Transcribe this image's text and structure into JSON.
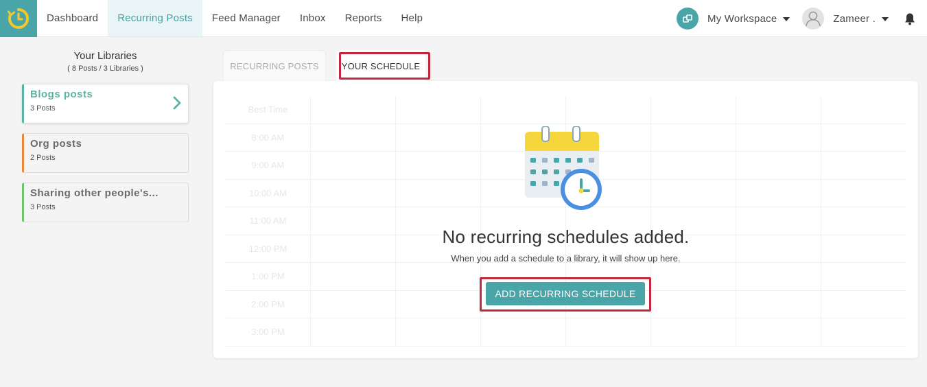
{
  "nav": {
    "items": [
      {
        "label": "Dashboard",
        "active": false
      },
      {
        "label": "Recurring Posts",
        "active": true
      },
      {
        "label": "Feed Manager",
        "active": false
      },
      {
        "label": "Inbox",
        "active": false
      },
      {
        "label": "Reports",
        "active": false
      },
      {
        "label": "Help",
        "active": false
      }
    ],
    "workspace_label": "My Workspace",
    "user_label": "Zameer ."
  },
  "sidebar": {
    "title": "Your Libraries",
    "subtitle": "( 8 Posts / 3 Libraries )",
    "libraries": [
      {
        "name": "Blogs posts",
        "count": "3 Posts",
        "color": "#5bb3a2",
        "active": true
      },
      {
        "name": "Org posts",
        "count": "2 Posts",
        "color": "#e8883a",
        "active": false
      },
      {
        "name": "Sharing other people's...",
        "count": "3 Posts",
        "color": "#6cc56c",
        "active": false
      }
    ]
  },
  "tabs": [
    {
      "label": "RECURRING POSTS",
      "active": false
    },
    {
      "label": "YOUR SCHEDULE",
      "active": true
    }
  ],
  "schedule": {
    "header": "Best Time",
    "times": [
      "8:00 AM",
      "9:00 AM",
      "10:00 AM",
      "11:00 AM",
      "12:00 PM",
      "1:00 PM",
      "2:00 PM",
      "3:00 PM"
    ]
  },
  "empty_state": {
    "title": "No recurring schedules added.",
    "subtitle": "When you add a schedule to a library, it will show up here.",
    "button_label": "ADD RECURRING SCHEDULE"
  },
  "colors": {
    "brand": "#4aa5a8",
    "highlight": "#c2283b",
    "logo_yellow": "#f2c82b"
  }
}
